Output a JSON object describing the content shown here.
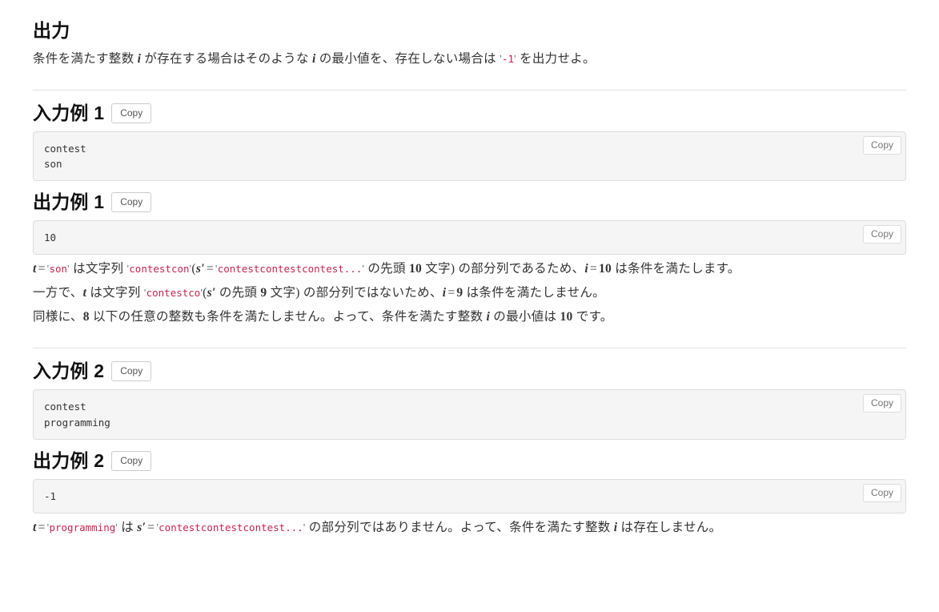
{
  "sections": {
    "output_spec": {
      "heading": "出力",
      "text_before": "条件を満たす整数 ",
      "var_i": "i",
      "text_mid": " が存在する場合はそのような ",
      "text_mid2": " の最小値を、存在しない場合は ",
      "quote_open": "'",
      "code_minus1": "-1",
      "quote_close": "'",
      "text_after": " を出力せよ。"
    },
    "sample_input_1": {
      "heading": "入力例 1",
      "copy_label": "Copy",
      "block_copy_label": "Copy",
      "content": "contest\nson"
    },
    "sample_output_1": {
      "heading": "出力例 1",
      "copy_label": "Copy",
      "block_copy_label": "Copy",
      "content": "10"
    },
    "explanation_1": {
      "line1": {
        "var_t": "t",
        "eq": "=",
        "q1_open": "'",
        "code_son": "son",
        "q1_close": "'",
        "text1": " は文字列 ",
        "q2_open": "'",
        "code_contestcon": "contestcon",
        "q2_close": "'",
        "paren_open": "(",
        "var_s": "s",
        "prime": "′",
        "eq2": "=",
        "q3_open": "'",
        "code_contest_repeat": "contestcontestcontest...",
        "q3_close": "'",
        "text2": " の先頭 ",
        "num10": "10",
        "text3": " 文字",
        "paren_close": ")",
        "text4": " の部分列であるため、",
        "var_i": "i",
        "eq3": "=",
        "num10b": "10",
        "text5": " は条件を満たします。"
      },
      "line2": {
        "text0": "一方で、",
        "var_t": "t",
        "text1": " は文字列 ",
        "q_open": "'",
        "code_contestco": "contestco",
        "q_close": "'",
        "paren_open": "(",
        "var_s": "s",
        "prime": "′",
        "text2": " の先頭 ",
        "num9": "9",
        "text3": " 文字",
        "paren_close": ")",
        "text4": " の部分列ではないため、",
        "var_i": "i",
        "eq": "=",
        "num9b": "9",
        "text5": " は条件を満たしません。"
      },
      "line3": {
        "text0": "同様に、",
        "num8": "8",
        "text1": " 以下の任意の整数も条件を満たしません。よって、条件を満たす整数 ",
        "var_i": "i",
        "text2": " の最小値は ",
        "num10": "10",
        "text3": " です。"
      }
    },
    "sample_input_2": {
      "heading": "入力例 2",
      "copy_label": "Copy",
      "block_copy_label": "Copy",
      "content": "contest\nprogramming"
    },
    "sample_output_2": {
      "heading": "出力例 2",
      "copy_label": "Copy",
      "block_copy_label": "Copy",
      "content": "-1"
    },
    "explanation_2": {
      "line1": {
        "var_t": "t",
        "eq": "=",
        "q1_open": "'",
        "code_programming": "programming",
        "q1_close": "'",
        "text1": " は ",
        "var_s": "s",
        "prime": "′",
        "eq2": "=",
        "q2_open": "'",
        "code_contest_repeat": "contestcontestcontest...",
        "q2_close": "'",
        "text2": " の部分列ではありません。よって、条件を満たす整数 ",
        "var_i": "i",
        "text3": " は存在しません。"
      }
    }
  },
  "colors": {
    "code_inline": "#c7254e",
    "code_bg": "#f5f5f5",
    "border": "#dddddd",
    "text": "#333333"
  }
}
